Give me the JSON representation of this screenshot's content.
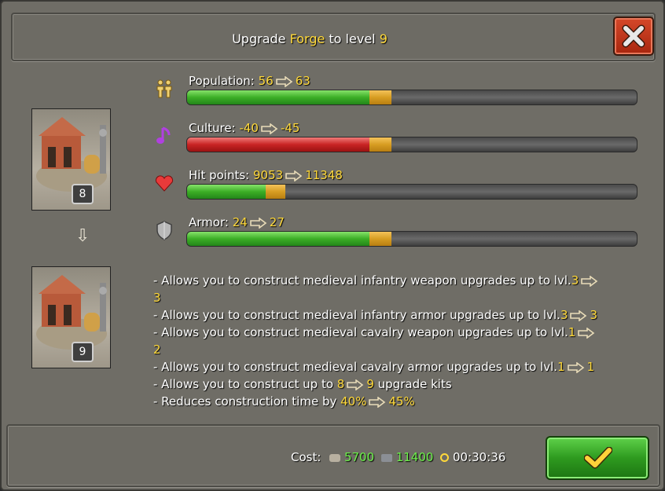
{
  "header": {
    "title_prefix": "Upgrade",
    "building_name": "Forge",
    "title_mid": "to level",
    "target_level": "9"
  },
  "thumbnails": {
    "current_level": "8",
    "next_level": "9"
  },
  "stats": [
    {
      "label": "Population:",
      "from": "56",
      "to": "63",
      "icon": "population-icon",
      "bar_color": "green",
      "fill_before": 0.405,
      "fill_after": 0.454
    },
    {
      "label": "Culture:",
      "from": "-40",
      "to": "-45",
      "icon": "culture-note-icon",
      "bar_color": "red",
      "fill_before": 0.405,
      "fill_after": 0.454
    },
    {
      "label": "Hit points:",
      "from": "9053",
      "to": "11348",
      "icon": "heart-icon",
      "bar_color": "green",
      "fill_before": 0.174,
      "fill_after": 0.219
    },
    {
      "label": "Armor:",
      "from": "24",
      "to": "27",
      "icon": "shield-icon",
      "bar_color": "green",
      "fill_before": 0.405,
      "fill_after": 0.454
    }
  ],
  "description": [
    {
      "text": "- Allows you to construct medieval infantry weapon upgrades up to lvl.",
      "from": "3",
      "to": "3",
      "wrap": true
    },
    {
      "text": "- Allows you to construct medieval infantry armor upgrades up to lvl.",
      "from": "3",
      "to": "3",
      "wrap": false
    },
    {
      "text": "- Allows you to construct medieval cavalry weapon upgrades up to lvl.",
      "from": "1",
      "to": "2",
      "wrap": true
    },
    {
      "text": "- Allows you to construct medieval cavalry armor upgrades up to lvl.",
      "from": "1",
      "to": "1",
      "wrap": false
    },
    {
      "text": "- Allows you to construct up to ",
      "from": "8",
      "to": "9",
      "suffix": " upgrade kits",
      "wrap": false
    },
    {
      "text": "- Reduces construction time by ",
      "from": "40%",
      "to": "45%",
      "wrap": false
    }
  ],
  "footer": {
    "cost_label": "Cost:",
    "stone": "5700",
    "iron": "11400",
    "time": "00:30:36"
  },
  "colors": {
    "highlight": "#ffd93a",
    "resource": "#6cf04a",
    "close_button": "#c0381c",
    "confirm_button": "#3aa828"
  }
}
